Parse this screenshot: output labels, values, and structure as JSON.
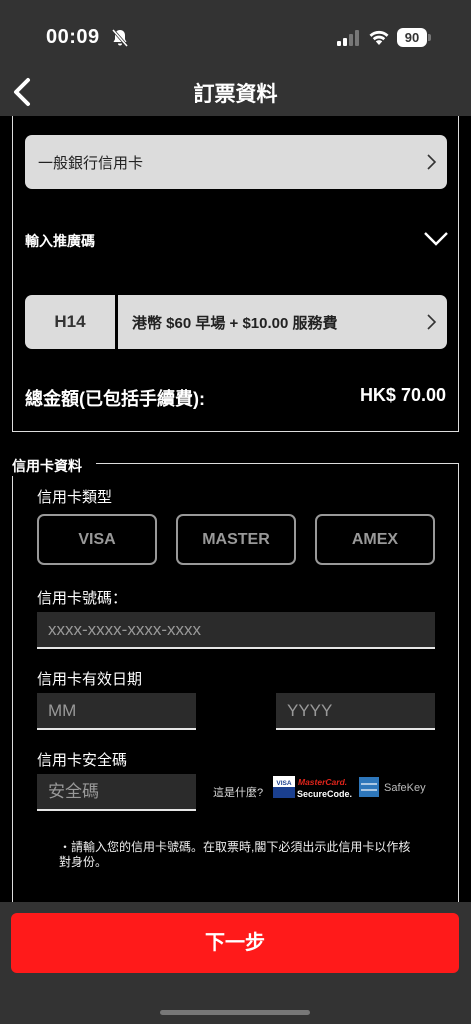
{
  "status": {
    "time": "00:09",
    "battery": "90"
  },
  "nav": {
    "title": "訂票資料"
  },
  "order": {
    "card_type_selected": "一般銀行信用卡",
    "promo_label": "輸入推廣碼",
    "ticket_code": "H14",
    "ticket_desc": "港幣 $60 早場 + $10.00 服務費",
    "total_label": "總金額(已包括手續費):",
    "total_value": "HK$ 70.00"
  },
  "card": {
    "legend": "信用卡資料",
    "type_label": "信用卡類型",
    "brands": [
      "VISA",
      "MASTER",
      "AMEX"
    ],
    "number_label": "信用卡號碼：",
    "number_placeholder": "xxxx-xxxx-xxxx-xxxx",
    "expiry_label": "信用卡有效日期",
    "month_placeholder": "MM",
    "year_placeholder": "YYYY",
    "cvv_label": "信用卡安全碼",
    "cvv_placeholder": "安全碼",
    "whats_this": "這是什麼?",
    "note": "・請輸入您的信用卡號碼。在取票時,閣下必須出示此信用卡以作核對身份。"
  },
  "logos": {
    "visa": "VISA",
    "mastercard_1": "MasterCard.",
    "mastercard_2": "SecureCode.",
    "safekey": "SafeKey"
  },
  "footer": {
    "next_label": "下一步"
  },
  "colors": {
    "accent": "#ff1a1a",
    "bar": "#333333"
  }
}
